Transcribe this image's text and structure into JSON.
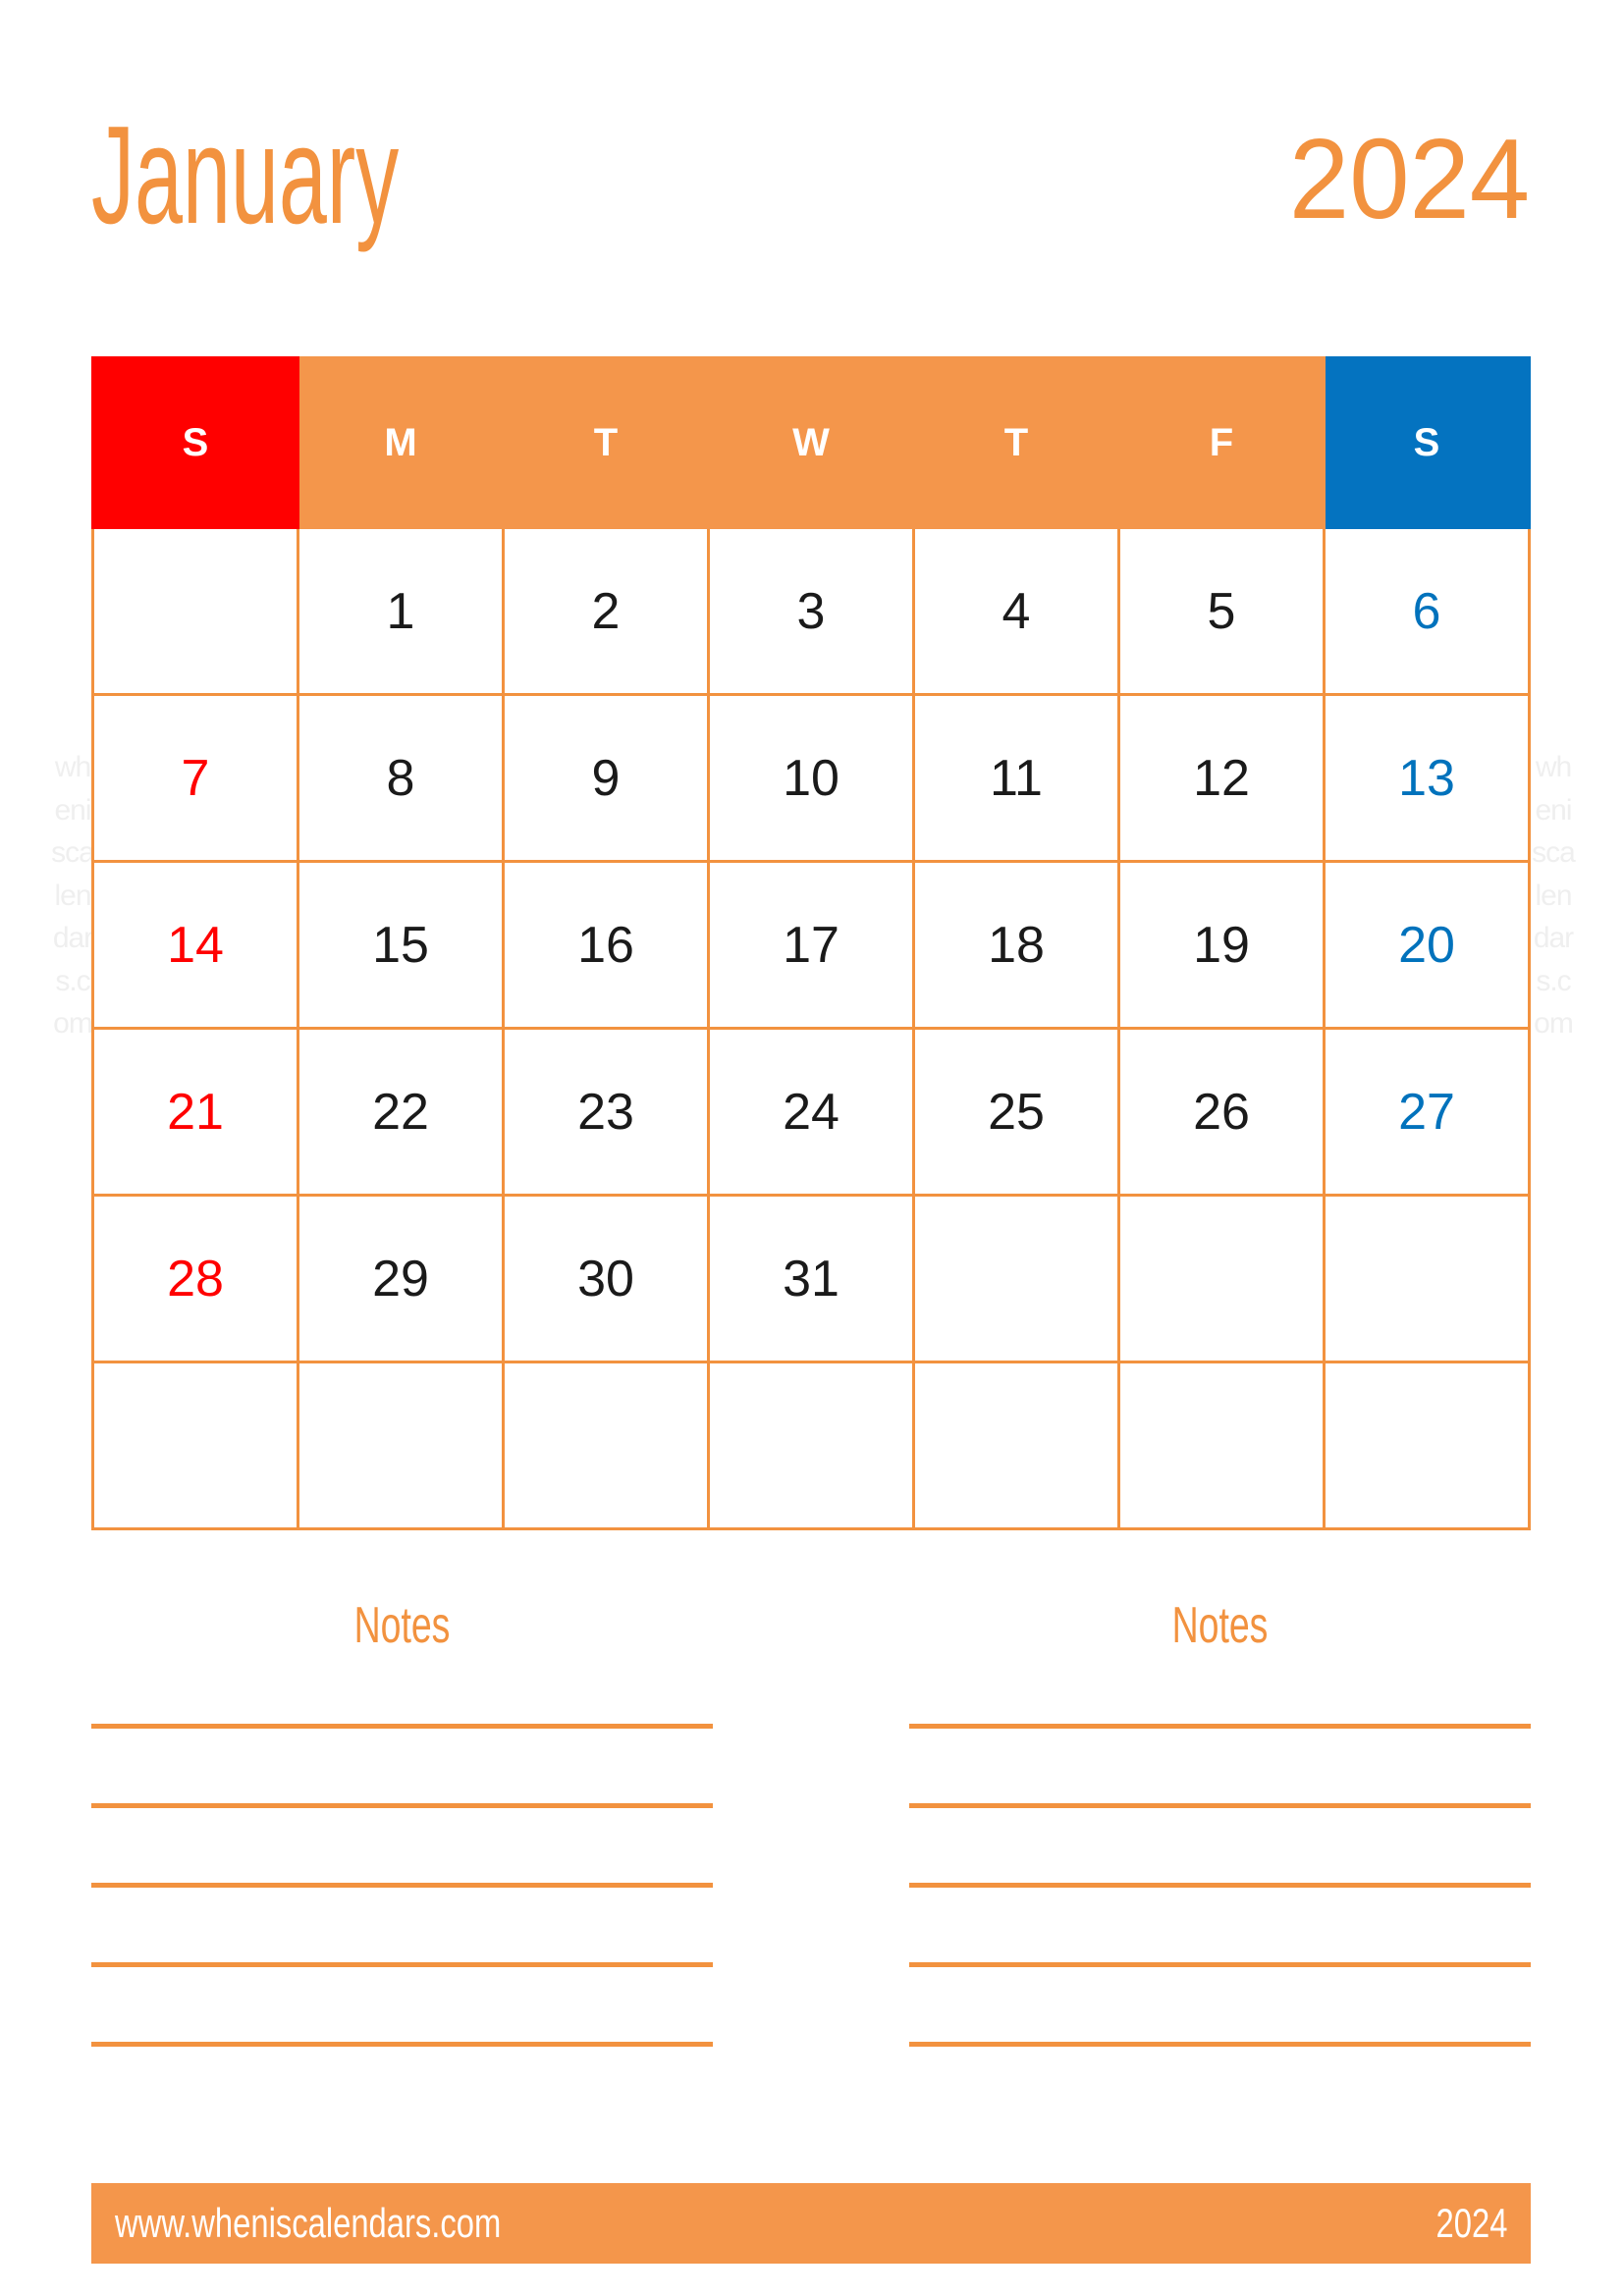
{
  "header": {
    "month": "January",
    "year": "2024"
  },
  "watermark": {
    "text": "wheniscalendars.com"
  },
  "calendar": {
    "weekday_headers": [
      {
        "label": "S",
        "kind": "sunday"
      },
      {
        "label": "M",
        "kind": "weekday"
      },
      {
        "label": "T",
        "kind": "weekday"
      },
      {
        "label": "W",
        "kind": "weekday"
      },
      {
        "label": "T",
        "kind": "weekday"
      },
      {
        "label": "F",
        "kind": "weekday"
      },
      {
        "label": "S",
        "kind": "saturday"
      }
    ],
    "weeks": [
      [
        "",
        "1",
        "2",
        "3",
        "4",
        "5",
        "6"
      ],
      [
        "7",
        "8",
        "9",
        "10",
        "11",
        "12",
        "13"
      ],
      [
        "14",
        "15",
        "16",
        "17",
        "18",
        "19",
        "20"
      ],
      [
        "21",
        "22",
        "23",
        "24",
        "25",
        "26",
        "27"
      ],
      [
        "28",
        "29",
        "30",
        "31",
        "",
        "",
        ""
      ],
      [
        "",
        "",
        "",
        "",
        "",
        "",
        ""
      ]
    ]
  },
  "notes": {
    "left_title": "Notes",
    "right_title": "Notes",
    "line_count": 5
  },
  "footer": {
    "url": "www.wheniscalendars.com",
    "year": "2024"
  },
  "colors": {
    "orange": "#F2923F",
    "orange_fill": "#F4964B",
    "sunday_red": "#FF0000",
    "saturday_blue": "#0072BC",
    "saturday_header_blue": "#0473C0",
    "watermark_gray": "#EFEFEF",
    "text_black": "#1A1A1A",
    "white": "#FFFFFF"
  }
}
